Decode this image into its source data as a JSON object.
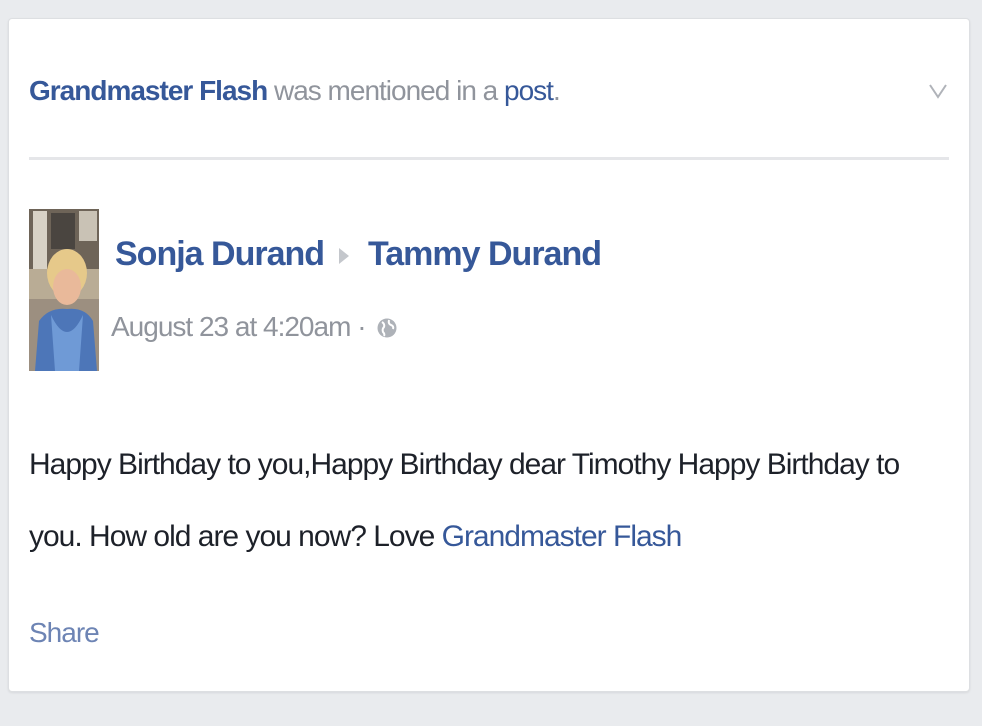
{
  "story": {
    "context": {
      "subject": "Grandmaster Flash",
      "text_middle": "was mentioned in a",
      "post_link": "post",
      "period": "."
    },
    "post": {
      "author": "Sonja Durand",
      "target": "Tammy Durand",
      "timestamp": "August 23 at 4:20am",
      "separator": "·",
      "body_text": "Happy Birthday to you,Happy Birthday dear Timothy Happy Birthday to you. How old are you now? Love ",
      "body_mention": "Grandmaster Flash",
      "share_label": "Share"
    }
  },
  "icons": {
    "options": "chevron-down-icon",
    "direction": "triangle-right-icon",
    "audience": "globe-icon"
  },
  "colors": {
    "link": "#365899",
    "meta": "#90949c",
    "text": "#1d2129",
    "share": "#6d84b4",
    "background": "#e9ebee"
  }
}
